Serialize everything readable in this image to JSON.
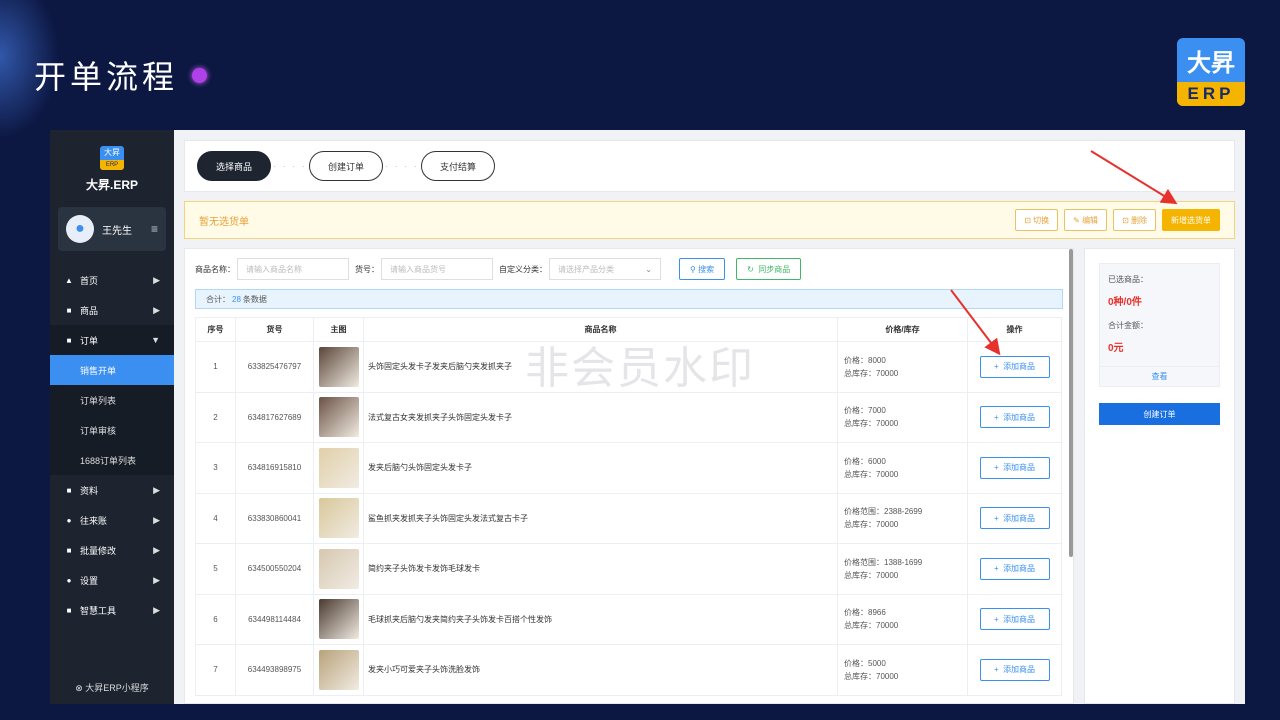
{
  "slide": {
    "title": "开单流程"
  },
  "brand_logo": {
    "top": "大昇",
    "bottom": "ERP"
  },
  "sidebar": {
    "logo_top": "大昇",
    "logo_bottom": "ERP",
    "app_name": "大昇.ERP",
    "user_name": "王先生",
    "menu_icon": "≡",
    "items": [
      {
        "label": "首页",
        "icon": "home-icon"
      },
      {
        "label": "商品",
        "icon": "goods-icon"
      },
      {
        "label": "订单",
        "icon": "order-icon"
      },
      {
        "label": "资料",
        "icon": "data-icon"
      },
      {
        "label": "往来账",
        "icon": "account-icon"
      },
      {
        "label": "批量修改",
        "icon": "batch-icon"
      },
      {
        "label": "设置",
        "icon": "settings-icon"
      },
      {
        "label": "智慧工具",
        "icon": "tools-icon"
      }
    ],
    "sub_items": [
      "销售开单",
      "订单列表",
      "订单审核",
      "1688订单列表"
    ],
    "footer": "大昇ERP小程序"
  },
  "steps": [
    "选择商品",
    "创建订单",
    "支付结算"
  ],
  "notice": {
    "text": "暂无选货单",
    "buttons": [
      "切换",
      "编辑",
      "删除",
      "新增选货单"
    ]
  },
  "filters": {
    "name_label": "商品名称：",
    "name_placeholder": "请输入商品名称",
    "sku_label": "货号：",
    "sku_placeholder": "请输入商品货号",
    "category_label": "自定义分类：",
    "category_placeholder": "请选择产品分类",
    "search_label": "搜索",
    "sync_label": "同步商品"
  },
  "total": {
    "prefix": "合计：",
    "count": "28",
    "suffix": "条数据"
  },
  "table": {
    "headers": [
      "序号",
      "货号",
      "主图",
      "商品名称",
      "价格/库存",
      "操作"
    ],
    "action_label": "添加商品",
    "rows": [
      {
        "idx": "1",
        "sku": "633825476797",
        "name": "头饰固定头发卡子发夹后脑勺夹发抓夹子",
        "price": "价格：8000",
        "stock": "总库存：70000",
        "img": "#5a4638"
      },
      {
        "idx": "2",
        "sku": "634817627689",
        "name": "法式复古女夹发抓夹子头饰固定头发卡子",
        "price": "价格：7000",
        "stock": "总库存：70000",
        "img": "#6b5244"
      },
      {
        "idx": "3",
        "sku": "634816915810",
        "name": "发夹后脑勺头饰固定头发卡子",
        "price": "价格：6000",
        "stock": "总库存：70000",
        "img": "#e0cfa8"
      },
      {
        "idx": "4",
        "sku": "633830860041",
        "name": "鲨鱼抓夹发抓夹子头饰固定头发法式复古卡子",
        "price": "价格范围：2388-2699",
        "stock": "总库存：70000",
        "img": "#d8c89a"
      },
      {
        "idx": "5",
        "sku": "634500550204",
        "name": "简约夹子头饰发卡发饰毛球发卡",
        "price": "价格范围：1388-1699",
        "stock": "总库存：70000",
        "img": "#d6c8b0"
      },
      {
        "idx": "6",
        "sku": "634498114484",
        "name": "毛球抓夹后脑勺发夹简约夹子头饰发卡百搭个性发饰",
        "price": "价格：8966",
        "stock": "总库存：70000",
        "img": "#4a3a30"
      },
      {
        "idx": "7",
        "sku": "634493898975",
        "name": "发夹小巧可爱夹子头饰洗脸发饰",
        "price": "价格：5000",
        "stock": "总库存：70000",
        "img": "#b8a27a"
      }
    ]
  },
  "watermark": "非会员水印",
  "summary": {
    "selected_label": "已选商品：",
    "selected_value": "0种/0件",
    "amount_label": "合计金额：",
    "amount_value": "0元",
    "view_label": "查看",
    "create_label": "创建订单"
  },
  "colors": {
    "accent": "#3a8ff0",
    "warning": "#f5b400",
    "danger": "#e6312d",
    "arrow": "#e6312d"
  }
}
